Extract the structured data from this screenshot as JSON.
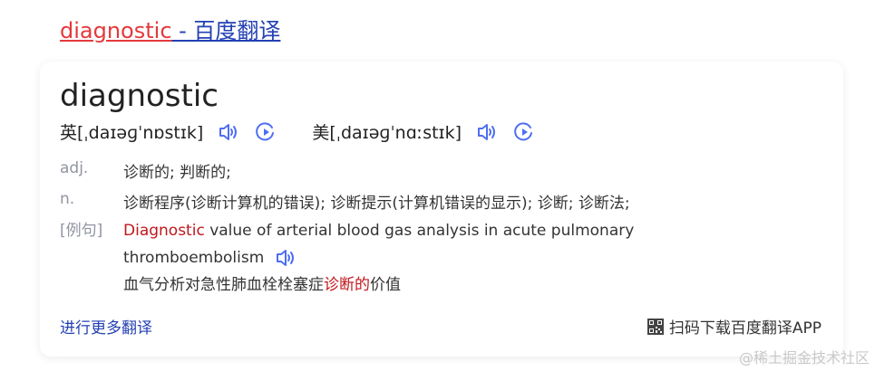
{
  "result": {
    "title_word": "diagnostic",
    "title_rest": " - 百度翻译"
  },
  "entry": {
    "word": "diagnostic",
    "phonetics": [
      {
        "label": "英[ˌdaɪəɡˈnɒstɪk]"
      },
      {
        "label": "美[ˌdaɪəɡˈnɑːstɪk]"
      }
    ],
    "definitions": [
      {
        "pos": "adj.",
        "meaning": "诊断的; 判断的;"
      },
      {
        "pos": "n.",
        "meaning": "诊断程序(诊断计算机的错误); 诊断提示(计算机错误的显示); 诊断; 诊断法;"
      }
    ],
    "example": {
      "label": "[例句]",
      "en_highlight": "Diagnostic",
      "en_rest_line1": " value of arterial blood gas analysis in acute pulmonary",
      "en_line2": "thromboembolism",
      "zh_before": "血气分析对急性肺血栓栓塞症",
      "zh_highlight": "诊断的",
      "zh_after": "价值"
    },
    "more_link": "进行更多翻译",
    "app_promo": "扫码下载百度翻译APP"
  },
  "watermark": "@稀土掘金技术社区",
  "colors": {
    "title_red": "#e4393c",
    "link_blue": "#2440b3",
    "icon_blue": "#4e6ef2",
    "highlight_red": "#c0161c",
    "muted": "#9195a3"
  },
  "icons": [
    "speaker-icon",
    "play-circle-icon",
    "qr-code-icon"
  ]
}
